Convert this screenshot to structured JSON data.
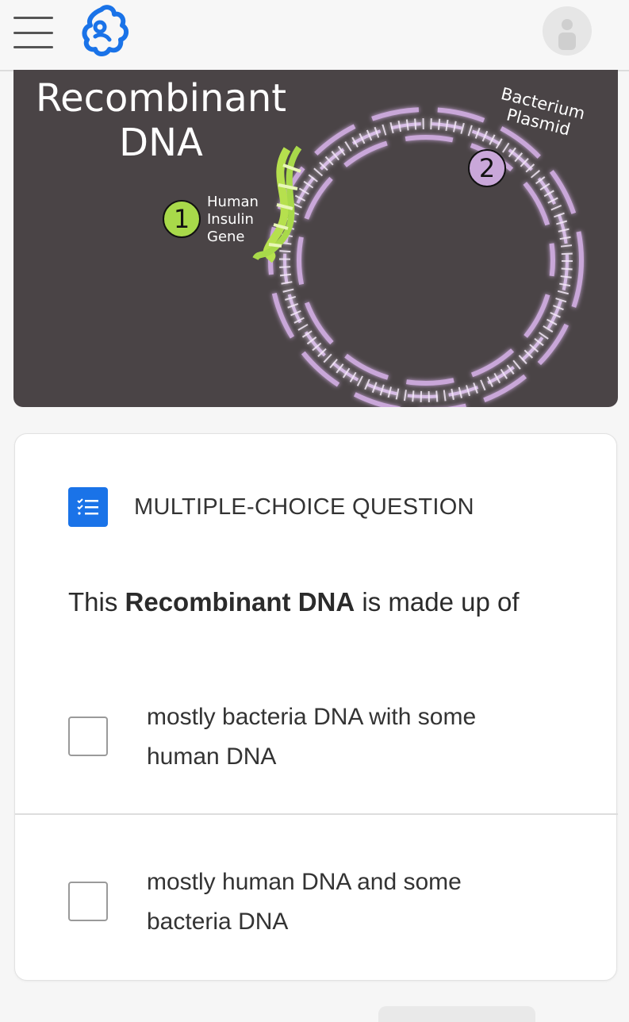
{
  "header": {
    "menu_icon": "hamburger-menu-icon",
    "logo_icon": "brand-logo-icon",
    "avatar_icon": "user-avatar-icon"
  },
  "hero": {
    "title_line1": "Recombinant",
    "title_line2": "DNA",
    "gene_label": [
      "Human",
      "Insulin",
      "Gene"
    ],
    "plasmid_label": [
      "Bacterium",
      "Plasmid"
    ],
    "badge_1": "1",
    "badge_2": "2",
    "colors": {
      "background": "#4a4446",
      "plasmid": "#c9a7d9",
      "gene": "#a8d94a"
    }
  },
  "question": {
    "type_icon": "checklist-icon",
    "type_label": "MULTIPLE-CHOICE QUESTION",
    "text_prefix": "This ",
    "text_bold": "Recombinant DNA",
    "text_suffix": " is made up of",
    "options": [
      {
        "line1": "mostly bacteria DNA with some",
        "line2": "human DNA",
        "checked": false
      },
      {
        "line1": "mostly human DNA and some",
        "line2": "bacteria DNA",
        "checked": false
      }
    ],
    "accent_color": "#1a73e8"
  }
}
